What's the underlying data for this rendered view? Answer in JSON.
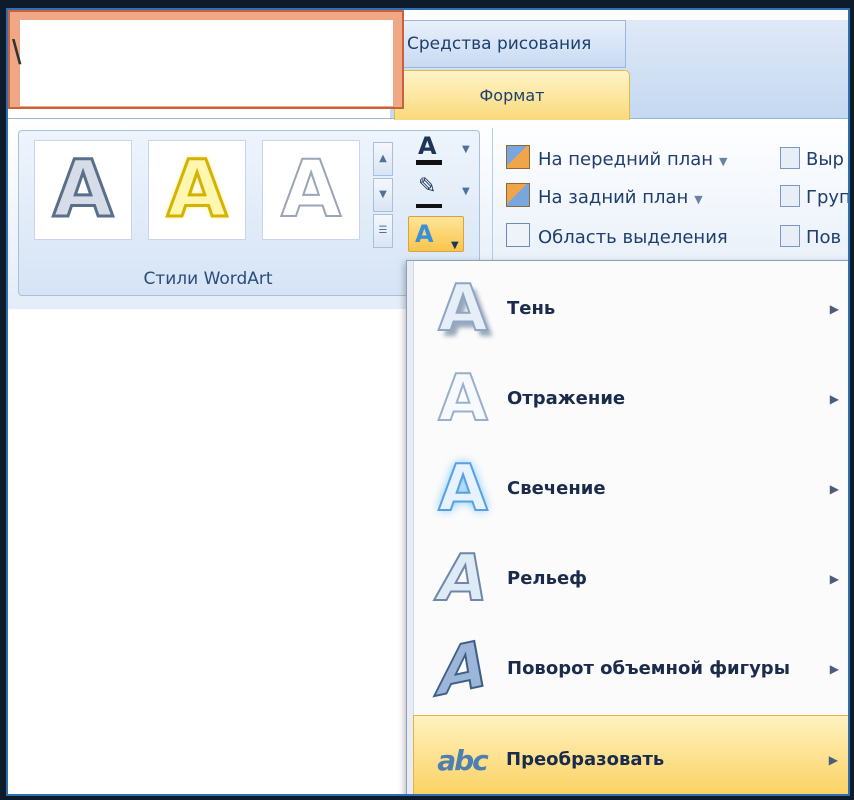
{
  "slide_fragment": "\\",
  "contextual_tab_group": "Средства рисования",
  "active_tab": "Формат",
  "wordart_group": {
    "label": "Стили WordArt",
    "sample_glyph": "A"
  },
  "arrange": {
    "items": [
      {
        "label": "На передний план",
        "icon": "bring-forward-icon",
        "dropdown": true
      },
      {
        "label": "На задний план",
        "icon": "send-backward-icon",
        "dropdown": true
      },
      {
        "label": "Область выделения",
        "icon": "selection-pane-icon",
        "dropdown": false
      }
    ],
    "right_items": [
      "Выр",
      "Груп",
      "Пов"
    ]
  },
  "text_effects_menu": {
    "items": [
      {
        "label": "Тень",
        "icon": "shadow-icon",
        "submenu": true
      },
      {
        "label": "Отражение",
        "icon": "reflection-icon",
        "submenu": true
      },
      {
        "label": "Свечение",
        "icon": "glow-icon",
        "submenu": true
      },
      {
        "label": "Рельеф",
        "icon": "bevel-icon",
        "submenu": true
      },
      {
        "label": "Поворот объемной фигуры",
        "icon": "3d-rotation-icon",
        "submenu": true
      },
      {
        "label": "Преобразовать",
        "icon": "transform-icon",
        "submenu": true,
        "highlighted": true
      }
    ],
    "transform_icon_text": "abc"
  },
  "colors": {
    "accent_tab": "#f9d97b",
    "highlight": "#fbcf5a",
    "ribbon_blue": "#c4d8f1"
  }
}
